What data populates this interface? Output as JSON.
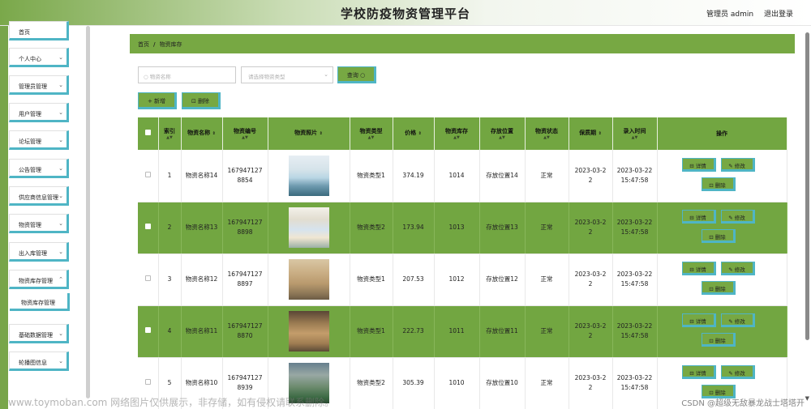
{
  "app": {
    "title": "学校防疫物资管理平台",
    "user_label": "管理员 admin",
    "logout": "退出登录"
  },
  "sidebar": {
    "items": [
      {
        "label": "首页"
      },
      {
        "label": "个人中心"
      },
      {
        "label": "管理员管理"
      },
      {
        "label": "用户管理"
      },
      {
        "label": "论坛管理"
      },
      {
        "label": "公告管理"
      },
      {
        "label": "供应商信息管理"
      },
      {
        "label": "物资管理"
      },
      {
        "label": "出入库管理"
      },
      {
        "label": "物资库存管理"
      },
      {
        "label": "基础数据管理"
      },
      {
        "label": "轮播图信息"
      }
    ],
    "submenu_label": "物资库存管理"
  },
  "breadcrumb": {
    "home": "首页",
    "separator": "/",
    "current": "物资库存"
  },
  "search": {
    "name_placeholder": "物资名称",
    "type_placeholder": "请选择物资类型",
    "query_label": "查询"
  },
  "actions": {
    "add_label": "新增",
    "delete_label": "删除"
  },
  "table": {
    "headers": [
      "索引",
      "物资名称",
      "物资编号",
      "物资照片",
      "物资类型",
      "价格",
      "物资库存",
      "存放位置",
      "物资状态",
      "保质期",
      "录入时间",
      "操作"
    ],
    "op_labels": {
      "detail": "详情",
      "edit": "修改",
      "delete": "删除"
    },
    "rows": [
      {
        "index": "1",
        "name": "物资名称14",
        "code": "1679471278854",
        "type": "物资类型1",
        "price": "374.19",
        "stock": "1014",
        "location": "存放位置14",
        "status": "正常",
        "expiry": "2023-03-22",
        "entry_time": "2023-03-22 15:47:58"
      },
      {
        "index": "2",
        "name": "物资名称13",
        "code": "1679471278898",
        "type": "物资类型2",
        "price": "173.94",
        "stock": "1013",
        "location": "存放位置13",
        "status": "正常",
        "expiry": "2023-03-22",
        "entry_time": "2023-03-22 15:47:58"
      },
      {
        "index": "3",
        "name": "物资名称12",
        "code": "1679471278897",
        "type": "物资类型1",
        "price": "207.53",
        "stock": "1012",
        "location": "存放位置12",
        "status": "正常",
        "expiry": "2023-03-22",
        "entry_time": "2023-03-22 15:47:58"
      },
      {
        "index": "4",
        "name": "物资名称11",
        "code": "1679471278870",
        "type": "物资类型1",
        "price": "222.73",
        "stock": "1011",
        "location": "存放位置11",
        "status": "正常",
        "expiry": "2023-03-22",
        "entry_time": "2023-03-22 15:47:58"
      },
      {
        "index": "5",
        "name": "物资名称10",
        "code": "1679471278939",
        "type": "物资类型2",
        "price": "305.39",
        "stock": "1010",
        "location": "存放位置10",
        "status": "正常",
        "expiry": "2023-03-22",
        "entry_time": "2023-03-22 15:47:58"
      }
    ]
  },
  "watermark": {
    "left": "www.toymoban.com 网络图片仅供展示，非存储，如有侵权请联系删除。",
    "right": "CSDN @超级无敌暴龙战士塔塔开"
  },
  "colors": {
    "accent": "#77a843",
    "button_border": "#4fb5c5"
  }
}
